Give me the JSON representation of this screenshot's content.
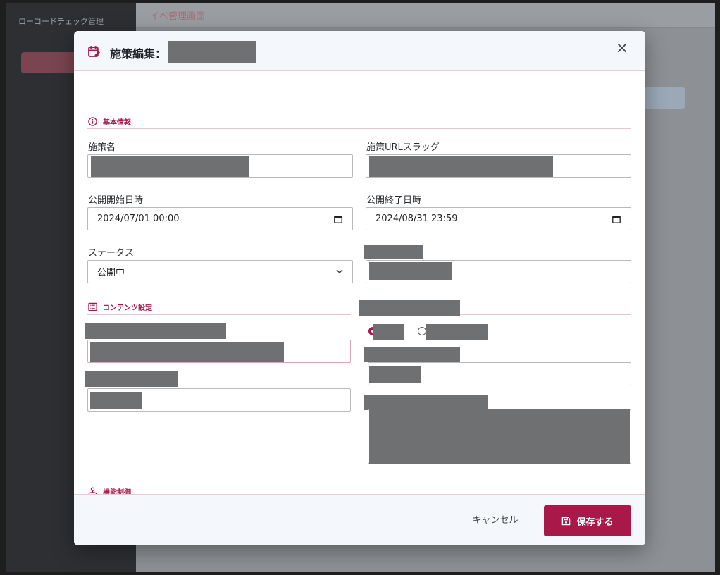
{
  "background": {
    "sidebar_brand": "ローコードチェック管理",
    "header_title": "イベ管理画面"
  },
  "modal": {
    "title": "施策編集：",
    "close_icon": "close-icon",
    "accent_color": "#a8194a"
  },
  "sections": {
    "basic": "基本情報",
    "contents": "コンテンツ設定",
    "features": "機能制御"
  },
  "fields": {
    "name_label": "施策名",
    "slug_label": "施策URLスラッグ",
    "start_label": "公開開始日時",
    "start_value": "2024/07/01 00:00",
    "end_label": "公開終了日時",
    "end_value": "2024/08/31 23:59",
    "status_label": "ステータス",
    "status_value": "公開中"
  },
  "footer": {
    "cancel_label": "キャンセル",
    "save_label": "保存する"
  },
  "toggles": [
    {
      "state": "on"
    },
    {
      "state": "on"
    },
    {
      "state": "off"
    }
  ]
}
